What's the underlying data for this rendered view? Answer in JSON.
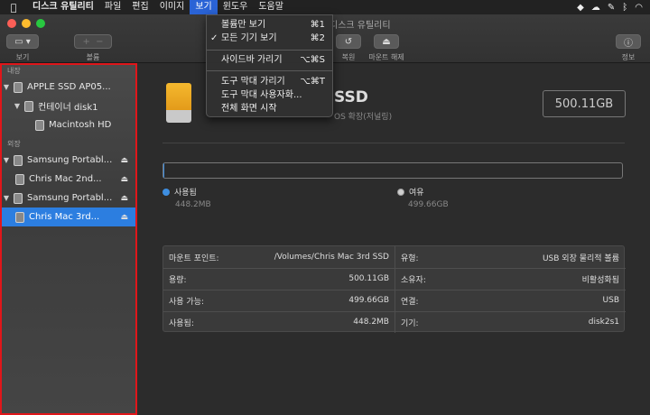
{
  "menubar": {
    "apple": "",
    "items": [
      "디스크 유틸리티",
      "파일",
      "편집",
      "이미지",
      "보기",
      "윈도우",
      "도움말"
    ],
    "right_icons": [
      "dropbox-icon",
      "cloud-icon",
      "tool-icon",
      "bluetooth-icon",
      "wifi-icon"
    ]
  },
  "window": {
    "title": "디스크 유틸리티"
  },
  "toolbar": {
    "view_label": "보기",
    "volume_label": "볼륨",
    "restore_label": "복원",
    "unmount_label": "마운트 해제",
    "info_label": "정보"
  },
  "view_menu": {
    "items": [
      {
        "check": "",
        "label": "볼륨만 보기",
        "shortcut": "⌘1"
      },
      {
        "check": "✓",
        "label": "모든 기기 보기",
        "shortcut": "⌘2"
      },
      {
        "check": "",
        "label": "사이드바 가리기",
        "shortcut": "⌥⌘S"
      },
      {
        "check": "",
        "label": "도구 막대 가리기",
        "shortcut": "⌥⌘T"
      },
      {
        "check": "",
        "label": "도구 막대 사용자화...",
        "shortcut": ""
      },
      {
        "check": "",
        "label": "전체 화면 시작",
        "shortcut": ""
      }
    ]
  },
  "sidebar": {
    "internal_header": "내장",
    "external_header": "외장",
    "items": [
      {
        "label": "APPLE SSD AP05...",
        "eject": ""
      },
      {
        "label": "컨테이너 disk1",
        "eject": ""
      },
      {
        "label": "Macintosh HD",
        "eject": ""
      },
      {
        "label": "Samsung Portabl...",
        "eject": "⏏"
      },
      {
        "label": "Chris Mac 2nd...",
        "eject": "⏏"
      },
      {
        "label": "Samsung Portabl...",
        "eject": "⏏"
      },
      {
        "label": "Chris Mac 3rd...",
        "eject": "⏏"
      }
    ]
  },
  "detail": {
    "name": "SSD",
    "subtitle": "OS 확장(저널링)",
    "size": "500.11GB",
    "used_label": "사용됨",
    "used_value": "448.2MB",
    "free_label": "여유",
    "free_value": "499.66GB",
    "used_color": "#3e8ee0",
    "free_color": "#cfcfcf",
    "used_fraction": 0.0009
  },
  "info": {
    "left": [
      {
        "k": "마운트 포인트:",
        "v": "/Volumes/Chris Mac 3rd SSD"
      },
      {
        "k": "용량:",
        "v": "500.11GB"
      },
      {
        "k": "사용 가능:",
        "v": "499.66GB"
      },
      {
        "k": "사용됨:",
        "v": "448.2MB"
      }
    ],
    "right": [
      {
        "k": "유형:",
        "v": "USB 외장 물리적 볼륨"
      },
      {
        "k": "소유자:",
        "v": "비활성화됨"
      },
      {
        "k": "연결:",
        "v": "USB"
      },
      {
        "k": "기기:",
        "v": "disk2s1"
      }
    ]
  },
  "colors": {
    "accent": "#2c7ee0",
    "highlight_border": "#e0161a"
  }
}
